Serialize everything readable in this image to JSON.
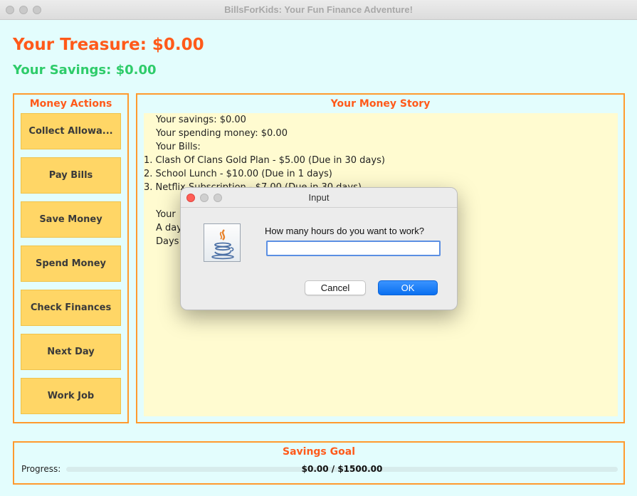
{
  "window": {
    "title": "BillsForKids: Your Fun Finance Adventure!"
  },
  "header": {
    "treasure": "Your Treasure: $0.00",
    "savings": "Your Savings: $0.00"
  },
  "actions": {
    "title": "Money Actions",
    "buttons": [
      "Collect Allowa...",
      "Pay Bills",
      "Save Money",
      "Spend Money",
      "Check Finances",
      "Next Day",
      "Work Job"
    ]
  },
  "story": {
    "title": "Your Money Story",
    "lines": [
      "Your savings: $0.00",
      "Your spending money: $0.00",
      "Your Bills:",
      "1. Clash Of Clans Gold Plan - $5.00 (Due in 30 days)",
      "2. School Lunch - $10.00 (Due in 1 days)",
      "3. Netflix Subscription - $7.00 (Due in 30 days)",
      "Your",
      "A day",
      "Days"
    ]
  },
  "goal": {
    "title": "Savings Goal",
    "progress_label": "Progress:",
    "progress_text": "$0.00 / $1500.00",
    "progress_fraction": 0.0
  },
  "dialog": {
    "title": "Input",
    "prompt": "How many hours do you want to work?",
    "input_value": "",
    "cancel_label": "Cancel",
    "ok_label": "OK",
    "icon": "java-icon"
  },
  "colors": {
    "background": "#e3fdfd",
    "accent_orange": "#ff5a1a",
    "savings_green": "#2ecc6a",
    "button_yellow": "#ffd666",
    "story_background": "#fffbd0",
    "ok_blue": "#0a6ff0"
  }
}
